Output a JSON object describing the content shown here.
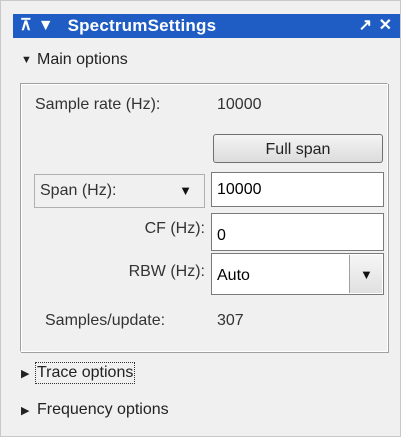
{
  "titlebar": {
    "title": "SpectrumSettings",
    "icons": [
      "undock-icon",
      "collapse-icon",
      "maximize-icon",
      "close-icon"
    ],
    "background": "#1f5dc4"
  },
  "sections": {
    "main_options": "Main options",
    "trace_options": "Trace options",
    "frequency_options": "Frequency options"
  },
  "main": {
    "sample_rate_label": "Sample rate (Hz):",
    "sample_rate_value": "10000",
    "full_span_button": "Full span",
    "span_dropdown": {
      "selected": "Span (Hz):"
    },
    "span_value": "10000",
    "cf_label": "CF (Hz):",
    "cf_value": "0",
    "rbw_label": "RBW (Hz):",
    "rbw_value": "Auto",
    "samples_update_label": "Samples/update:",
    "samples_update_value": "307"
  }
}
